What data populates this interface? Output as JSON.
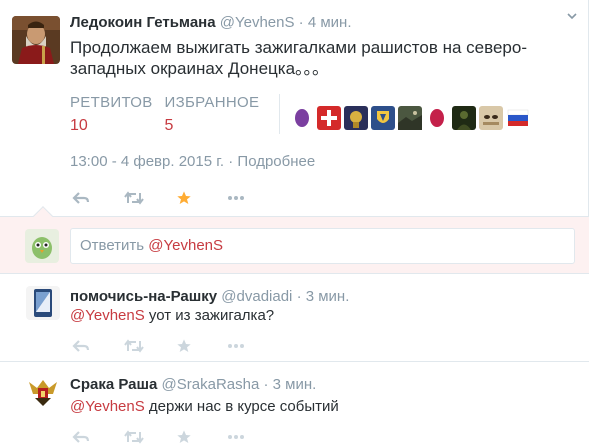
{
  "main_tweet": {
    "fullname": "Ледокоин Гетьмана",
    "username": "@YevhenS",
    "separator": "·",
    "time": "4 мин.",
    "text": "Продолжаем выжигать зажигалками рашистов на северо-западных окраинах Донецка。。。",
    "stats": {
      "retweets_label": "РЕТВИТОВ",
      "retweets_value": "10",
      "favorites_label": "ИЗБРАННОЕ",
      "favorites_value": "5"
    },
    "favorited_avatars": [
      "egg-purple-avatar",
      "red-cross-avatar",
      "emblem-avatar",
      "shield-avatar",
      "dark-photo-avatar",
      "egg-red-avatar",
      "dark-figure-avatar",
      "eyes-avatar",
      "flag-avatar"
    ],
    "timestamp": "13:00 - 4 февр. 2015 г.",
    "details_link": "Подробнее",
    "favorited": true,
    "icons": [
      "reply-icon",
      "retweet-icon",
      "favorite-icon",
      "more-icon"
    ]
  },
  "reply_box": {
    "placeholder_prefix": "Ответить ",
    "placeholder_mention": "@YevhenS"
  },
  "replies": [
    {
      "fullname": "помочись-на-Рашку",
      "username": "@dvadiadi",
      "separator": "·",
      "time": "3 мин.",
      "mention": "@YevhenS",
      "text": " уот из зажигалка?"
    },
    {
      "fullname": "Срака Раша",
      "username": "@SrakaRasha",
      "separator": "·",
      "time": "3 мин.",
      "mention": "@YevhenS",
      "text": " держи нас в курсе событий"
    }
  ],
  "colors": {
    "accent": "#c73b41",
    "muted": "#8899a6",
    "text": "#292f33",
    "favorite_star": "#ffac33",
    "reply_bg": "#fdf1f1"
  }
}
